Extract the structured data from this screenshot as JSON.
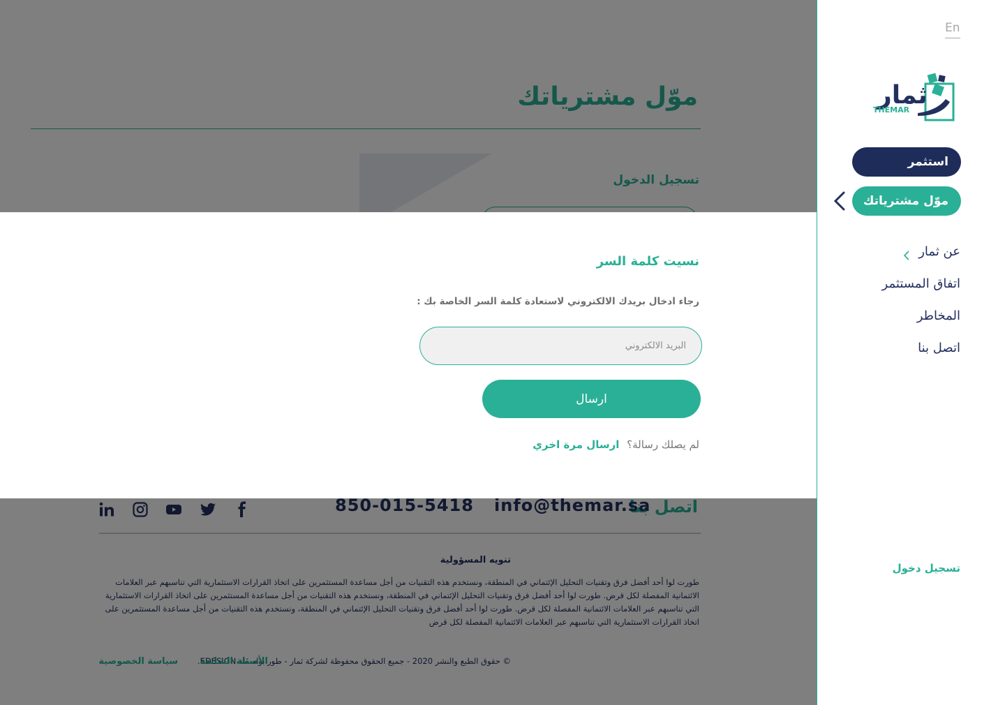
{
  "main": {
    "title": "موّل مشترياتك",
    "login_label": "تسجيل الدخول",
    "footer": {
      "contact_title": "اتصل بنا",
      "email": "info@themar.sa",
      "phone": "850-015-5418",
      "social_icons": [
        "facebook-icon",
        "twitter-icon",
        "youtube-icon",
        "instagram-icon",
        "linkedin-icon"
      ],
      "disclaimer_title": "تنويه المسؤولية",
      "disclaimer_text": "طورت لوا أحد أفضل فرق وتقنيات التحليل الإئتماني في المنطقة، ونستخدم هذه التقنيات من أجل مساعدة المستثمرين على اتخاذ القرارات الاستثمارية التي تناسبهم عبر العلامات الائتمانية المفصلة لكل قرض. طورت لوا أحد أفضل فرق وتقنيات التحليل الإئتماني في المنطقة، ونستخدم هذه التقنيات من أجل مساعدة المستثمرين على اتخاذ القرارات الاستثمارية التي تناسبهم عبر العلامات الائتمانية المفصلة لكل قرض. طورت لوا أحد أفضل فرق وتقنيات التحليل الإئتماني في المنطقة، ونستخدم هذه التقنيات من أجل مساعدة المستثمرين على اتخاذ القرارات الاستثمارية التي تناسبهم عبر العلامات الائتمانية المفصلة لكل قرض",
      "copyright": "© حقوق الطبع والنشر 2020 - جميع الحقوق محفوظة لشركة ثمار - طور بواسطة EDESIGN.",
      "faq_link": "الأسئلة الشائعة",
      "privacy_link": "سياسة الخصوصية"
    }
  },
  "modal": {
    "title": "نسيت كلمة السر",
    "description": "رجاء ادخال بريدك الالكتروني لاستعادة كلمة السر الخاصة بك :",
    "email_placeholder": "البريد الالكتروني",
    "email_value": "",
    "send_button": "ارسال",
    "resend_question": "لم يصلك رسالة؟",
    "resend_link": "ارسال مرة اخري"
  },
  "sidebar": {
    "lang": "En",
    "logo_text_ar": "ثمار",
    "logo_text_en": "THEMAR",
    "nav_primary": [
      {
        "label": "استثمر",
        "color": "#1e2c5a"
      },
      {
        "label": "موّل مشترياتك",
        "color": "#2ab096",
        "active": true
      }
    ],
    "nav_links": [
      "عن ثمار",
      "اتفاق المستثمر",
      "المخاطر",
      "اتصل بنا"
    ],
    "login": "تسجيل دخول"
  },
  "colors": {
    "brand_green": "#2ab096",
    "brand_navy": "#1e2c5a",
    "overlay": "rgba(0,0,0,0.5)"
  }
}
